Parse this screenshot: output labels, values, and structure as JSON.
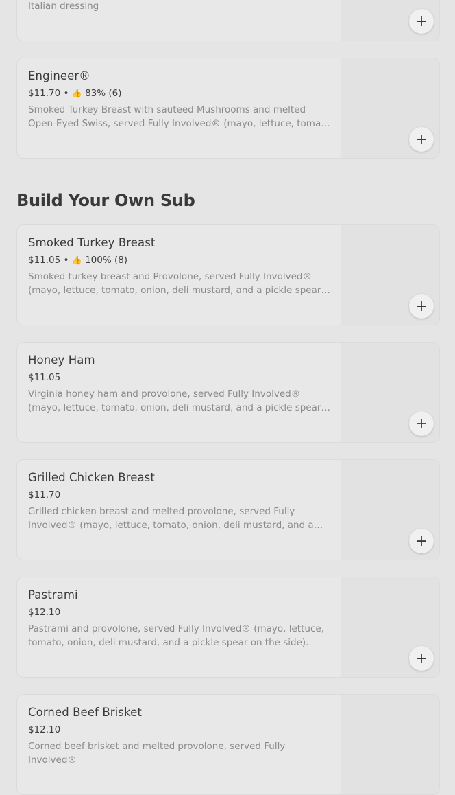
{
  "top_card": {
    "desc_tail": "Italian dressing",
    "add_icon": "+"
  },
  "first_items": [
    {
      "name": "Engineer®",
      "price": "$11.70",
      "rating": "83% (6)",
      "desc": "Smoked Turkey Breast with sauteed Mushrooms and melted Open-Eyed Swiss, served Fully Involved® (mayo, lettuce, tomato, onion, deli mustard, and a pickle spear on the side)."
    }
  ],
  "section": {
    "title": "Build Your Own Sub"
  },
  "items": [
    {
      "name": "Smoked Turkey Breast",
      "price": "$11.05",
      "rating": "100% (8)",
      "desc": "Smoked turkey breast and Provolone, served Fully Involved® (mayo, lettuce, tomato, onion, deli mustard, and a pickle spear on the side)."
    },
    {
      "name": "Honey Ham",
      "price": "$11.05",
      "rating": "",
      "desc": "Virginia honey ham and provolone, served Fully Involved® (mayo, lettuce, tomato, onion, deli mustard, and a pickle spear on the side)."
    },
    {
      "name": "Grilled Chicken Breast",
      "price": "$11.70",
      "rating": "",
      "desc": "Grilled chicken breast and melted provolone, served Fully Involved® (mayo, lettuce, tomato, onion, deli mustard, and a pickle spear on the side)."
    },
    {
      "name": "Pastrami",
      "price": "$12.10",
      "rating": "",
      "desc": "Pastrami and provolone, served Fully Involved® (mayo, lettuce, tomato, onion, deli mustard, and a pickle spear on the side)."
    },
    {
      "name": "Corned Beef Brisket",
      "price": "$12.10",
      "rating": "",
      "desc": "Corned beef brisket and melted provolone, served Fully Involved®"
    }
  ],
  "icons": {
    "add": "plus-icon",
    "rating": "thumbs-up-icon"
  },
  "separator": "•"
}
